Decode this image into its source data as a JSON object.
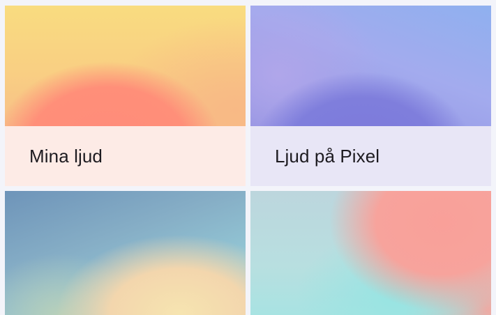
{
  "sound_categories": [
    {
      "label": "Mina ljud"
    },
    {
      "label": "Ljud på Pixel"
    },
    {
      "label": ""
    },
    {
      "label": ""
    }
  ]
}
